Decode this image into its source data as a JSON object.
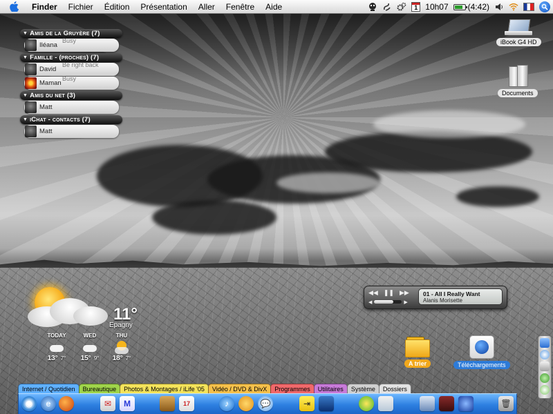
{
  "menubar": {
    "app_name": "Finder",
    "menus": [
      "Fichier",
      "Édition",
      "Présentation",
      "Aller",
      "Fenêtre",
      "Aide"
    ],
    "extras": {
      "calendar_day": "1",
      "clock": "10h07",
      "battery_time": "(4:42)",
      "battery_level": 0.8
    }
  },
  "buddy_list": {
    "groups": [
      {
        "label": "Amis de la Gruyère (7)",
        "buddies": [
          {
            "name": "Iléana",
            "status": "Busy"
          }
        ]
      },
      {
        "label": "Famille - (proches) (7)",
        "buddies": [
          {
            "name": "David",
            "status": "Be right back"
          },
          {
            "name": "Maman",
            "status": "Busy"
          }
        ]
      },
      {
        "label": "Amis du net (3)",
        "buddies": [
          {
            "name": "Matt",
            "status": ""
          }
        ]
      },
      {
        "label": "iChat - contacts (7)",
        "buddies": [
          {
            "name": "Matt",
            "status": ""
          }
        ]
      }
    ]
  },
  "desktop": {
    "icons": [
      {
        "label": "iBook G4 HD",
        "icon": "laptop-icon"
      },
      {
        "label": "Documents",
        "icon": "documents-icon"
      },
      {
        "label": "A trier",
        "icon": "folder-icon"
      },
      {
        "label": "Téléchargements",
        "icon": "downloads-icon"
      }
    ]
  },
  "weather": {
    "temp": "11°",
    "city": "Epagny",
    "forecast": [
      {
        "day": "TODAY",
        "high": "13°",
        "low": "7°",
        "icon": "cloud-icon"
      },
      {
        "day": "WED",
        "high": "15°",
        "low": "9°",
        "icon": "cloud-icon"
      },
      {
        "day": "THU",
        "high": "18°",
        "low": "7°",
        "icon": "sun-icon"
      }
    ]
  },
  "itunes": {
    "track": "01 - All I Really Want",
    "artist": "Alanis Morisette",
    "volume": 0.7
  },
  "dock": {
    "tabs": [
      {
        "label": "Internet / Quotidien",
        "color": "#5fb0ff"
      },
      {
        "label": "Bureautique",
        "color": "#9fd44a"
      },
      {
        "label": "Photos & Montages / iLife '05",
        "color": "#f4e35a"
      },
      {
        "label": "Vidéo / DVD & DivX",
        "color": "#f6c04a"
      },
      {
        "label": "Programmes",
        "color": "#f0686a"
      },
      {
        "label": "Utilitaires",
        "color": "#c77ad8"
      },
      {
        "label": "Système",
        "color": "#cfcfcf"
      },
      {
        "label": "Dossiers",
        "color": "#e2e2e2"
      }
    ]
  }
}
